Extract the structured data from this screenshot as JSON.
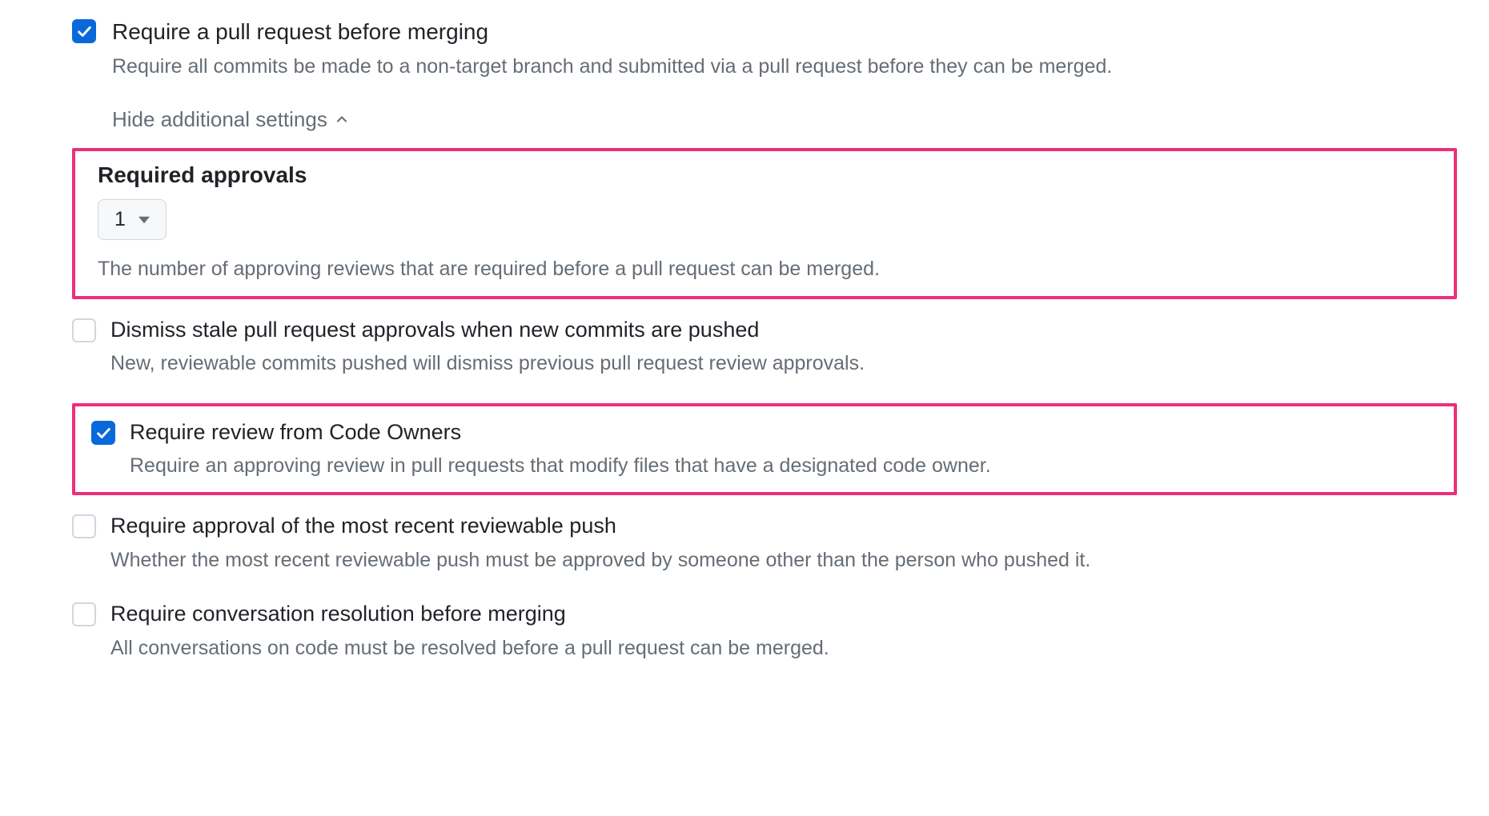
{
  "main": {
    "title": "Require a pull request before merging",
    "desc": "Require all commits be made to a non-target branch and submitted via a pull request before they can be merged.",
    "toggle": "Hide additional settings"
  },
  "approvals": {
    "heading": "Required approvals",
    "value": "1",
    "desc": "The number of approving reviews that are required before a pull request can be merged."
  },
  "options": {
    "dismiss": {
      "title": "Dismiss stale pull request approvals when new commits are pushed",
      "desc": "New, reviewable commits pushed will dismiss previous pull request review approvals."
    },
    "codeowners": {
      "title": "Require review from Code Owners",
      "desc": "Require an approving review in pull requests that modify files that have a designated code owner."
    },
    "recentpush": {
      "title": "Require approval of the most recent reviewable push",
      "desc": "Whether the most recent reviewable push must be approved by someone other than the person who pushed it."
    },
    "conversation": {
      "title": "Require conversation resolution before merging",
      "desc": "All conversations on code must be resolved before a pull request can be merged."
    }
  }
}
